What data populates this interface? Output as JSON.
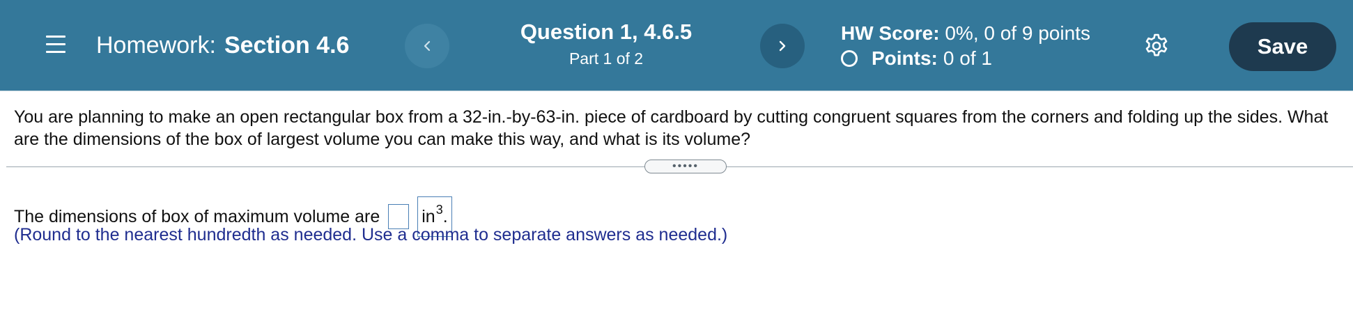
{
  "header": {
    "homework_label": "Homework:",
    "section_label": "Section 4.6",
    "question_title": "Question 1, 4.6.5",
    "part_label": "Part 1 of 2",
    "score_label": "HW Score:",
    "score_value": "0%, 0 of 9 points",
    "points_label": "Points:",
    "points_value": "0 of 1",
    "save_label": "Save",
    "prev_glyph": "‹",
    "next_glyph": "›",
    "colors": {
      "bar": "#34789a",
      "save": "#1e3a4f"
    }
  },
  "question": {
    "text": "You are planning to make an open rectangular box from a 32-in.-by-63-in. piece of cardboard by cutting congruent squares from the corners and folding up the sides. What are the dimensions of the box of largest volume you can make this way, and what is its volume?",
    "expander_label": "•••••"
  },
  "answer": {
    "prompt": "The dimensions of box of maximum volume are",
    "input_value": "",
    "unit": "in",
    "unit_exp": "3",
    "suffix": ".",
    "hint": "(Round to the nearest hundredth as needed. Use a comma to separate answers as needed.)"
  },
  "icons": [
    "menu-icon",
    "chevron-left-icon",
    "chevron-right-icon",
    "radio-circle-icon",
    "gear-icon"
  ]
}
